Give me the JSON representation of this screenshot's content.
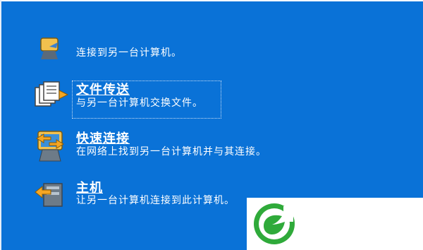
{
  "items": [
    {
      "title": "",
      "description": "连接到另一台计算机。",
      "icon": "connect-icon"
    },
    {
      "title": "文件传送",
      "description": "与另一台计算机交换文件。",
      "icon": "file-transfer-icon"
    },
    {
      "title": "快速连接",
      "description": "在网络上找到另一台计算机并与其连接。",
      "icon": "quick-connect-icon"
    },
    {
      "title": "主机",
      "description": "让另一台计算机连接到此计算机。",
      "icon": "host-icon"
    }
  ],
  "colors": {
    "background": "#0a72d7",
    "logo_green": "#2faa3a",
    "text": "#ffffff"
  },
  "logo": {
    "icon": "leaf-logo-icon"
  }
}
